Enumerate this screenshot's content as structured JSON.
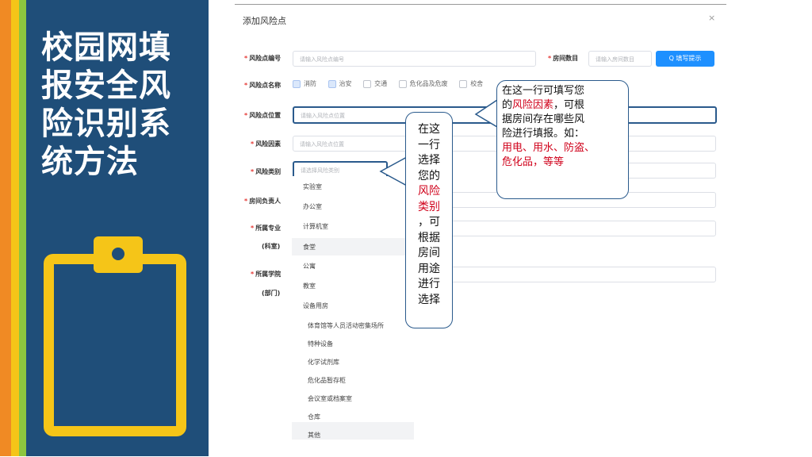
{
  "sidebar": {
    "title": "校园网填报安全风险识别系统方法"
  },
  "dialog": {
    "title": "添加风险点",
    "close": "×",
    "fields": {
      "code_label": "风险点编号",
      "code_placeholder": "请输入风险点编号",
      "rooms_label": "房间数目",
      "rooms_placeholder": "请输入房间数目",
      "fill_hint": "Q 填写提示",
      "name_label": "风险点名称",
      "location_label": "风险点位置",
      "location_placeholder": "请输入风险点位置",
      "factor_label": "风险因素",
      "factor_placeholder": "请输入风险点位置",
      "category_label": "风险类别",
      "category_placeholder": "请选择风险类别",
      "owner_label": "房间负责人",
      "major_label": "所属专业",
      "major_sub": "(科室)",
      "college_label": "所属学院",
      "college_sub": "(部门)"
    },
    "checkboxes": [
      "消防",
      "治安",
      "交通",
      "危化品及危废",
      "校舍",
      "场所"
    ],
    "dropdown": [
      "实验室",
      "办公室",
      "计算机室",
      "食堂",
      "公寓",
      "教室",
      "设备用房",
      "体育馆等人员活动密集场所",
      "特种设备",
      "化学试剂库",
      "危化品暂存柜",
      "会议室或档案室",
      "仓库",
      "其他"
    ]
  },
  "callout_right": {
    "line1": "在这一行可填写您",
    "line2a": "的",
    "line2b": "风险因素",
    "line2c": "，可根",
    "line3": "据房间存在哪些风",
    "line4": "险进行填报。如：",
    "line5": "用电、用水、防盗、",
    "line6": "危化品，等等"
  },
  "callout_left": {
    "lines_black1": [
      "在这",
      "一行",
      "选择",
      "您的"
    ],
    "lines_red": [
      "风险",
      "类别"
    ],
    "lines_black2": [
      "，可",
      "根据",
      "房间",
      "用途",
      "进行",
      "选择"
    ]
  },
  "colors": {
    "navy": "#1f4e79",
    "yellow": "#f5c518",
    "orange": "#f08a24",
    "green": "#8cc63f",
    "accent": "#1e90ff",
    "highlight": "#d0021b"
  }
}
